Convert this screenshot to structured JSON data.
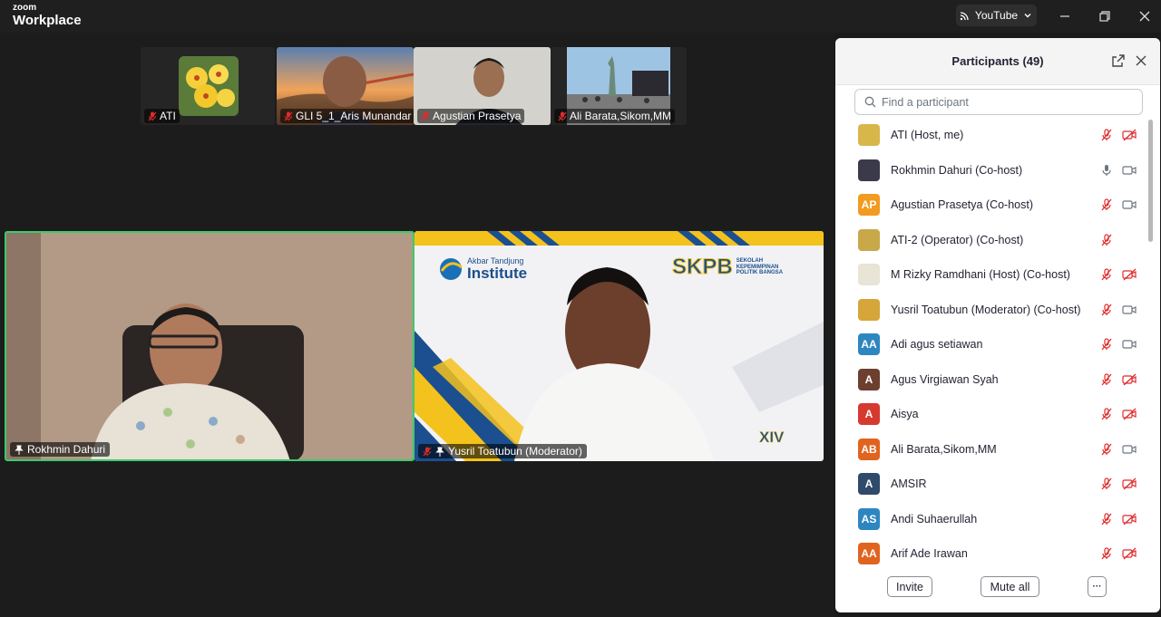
{
  "app": {
    "brand_top": "zoom",
    "brand_bottom": "Workplace"
  },
  "titlebar": {
    "stream_label": "YouTube"
  },
  "thumbnails": [
    {
      "name": "ATI"
    },
    {
      "name": "GLI 5_1_Aris Munandar"
    },
    {
      "name": "Agustian Prasetya"
    },
    {
      "name": "Ali Barata,Sikom,MM"
    }
  ],
  "tiles": [
    {
      "name": "Rokhmin Dahuri"
    },
    {
      "name": "Yusril Toatubun (Moderator)"
    }
  ],
  "slide": {
    "institute_small": "Akbar Tandjung",
    "institute_big": "Institute",
    "skpb": "SKPB",
    "skpb_sub1": "SEKOLAH",
    "skpb_sub2": "KEPEMIMPINAN",
    "skpb_sub3": "POLITIK BANGSA",
    "batch": "XIV"
  },
  "panel": {
    "title": "Participants (49)",
    "search_placeholder": "Find a participant",
    "invite_label": "Invite",
    "mute_all_label": "Mute all",
    "more_label": "···"
  },
  "participants": [
    {
      "name": "ATI (Host, me)",
      "initials": "",
      "avatar_color": "#d8b64a",
      "mic": "muted",
      "cam": "off"
    },
    {
      "name": "Rokhmin Dahuri (Co-host)",
      "initials": "",
      "avatar_color": "#3a3a4a",
      "mic": "on",
      "cam": "on"
    },
    {
      "name": "Agustian Prasetya (Co-host)",
      "initials": "AP",
      "avatar_color": "#f29b1f",
      "mic": "muted",
      "cam": "on"
    },
    {
      "name": "ATI-2 (Operator) (Co-host)",
      "initials": "",
      "avatar_color": "#c9a84a",
      "mic": "muted",
      "cam": "none"
    },
    {
      "name": "M Rizky Ramdhani (Host) (Co-host)",
      "initials": "",
      "avatar_color": "#e8e4d6",
      "mic": "muted",
      "cam": "off"
    },
    {
      "name": "Yusril Toatubun (Moderator) (Co-host)",
      "initials": "",
      "avatar_color": "#d6a63a",
      "mic": "muted",
      "cam": "on"
    },
    {
      "name": "Adi agus setiawan",
      "initials": "AA",
      "avatar_color": "#2e86c1",
      "mic": "muted",
      "cam": "on"
    },
    {
      "name": "Agus Virgiawan Syah",
      "initials": "A",
      "avatar_color": "#6d3f2e",
      "mic": "muted",
      "cam": "off"
    },
    {
      "name": "Aisya",
      "initials": "A",
      "avatar_color": "#d63a2f",
      "mic": "muted",
      "cam": "off"
    },
    {
      "name": "Ali Barata,Sikom,MM",
      "initials": "AB",
      "avatar_color": "#e0641f",
      "mic": "muted",
      "cam": "on"
    },
    {
      "name": "AMSIR",
      "initials": "A",
      "avatar_color": "#2f4a6b",
      "mic": "muted",
      "cam": "off"
    },
    {
      "name": "Andi Suhaerullah",
      "initials": "AS",
      "avatar_color": "#2e86c1",
      "mic": "muted",
      "cam": "off"
    },
    {
      "name": "Arif Ade Irawan",
      "initials": "AA",
      "avatar_color": "#e0641f",
      "mic": "muted",
      "cam": "off"
    }
  ],
  "colors": {
    "muted_red": "#e02b2b",
    "active_speaker": "#3ccb6b",
    "icon_gray": "#6e7680"
  }
}
